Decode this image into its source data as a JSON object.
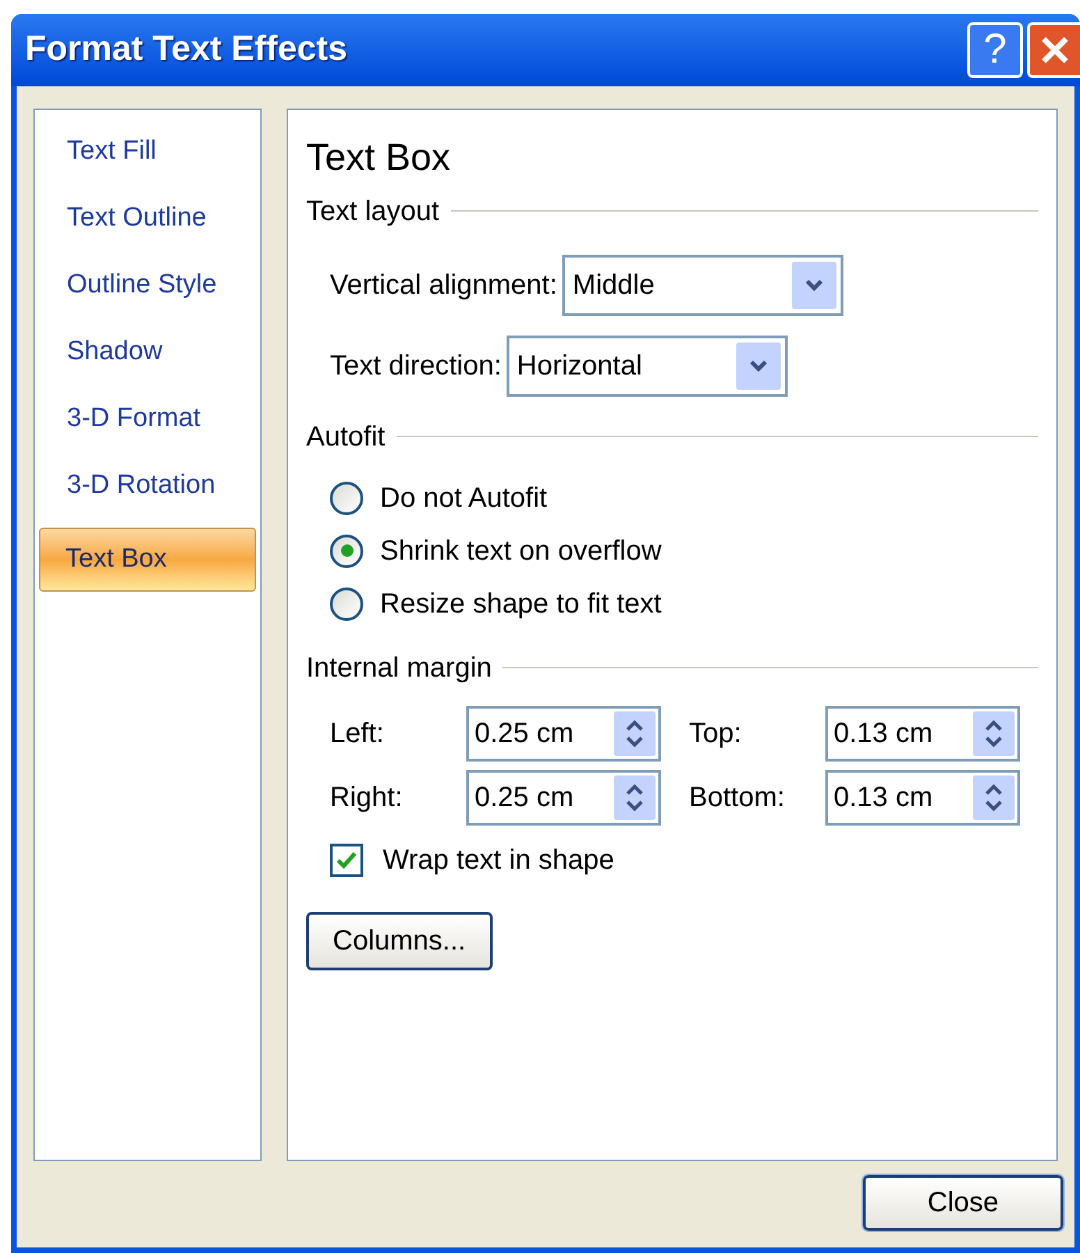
{
  "window": {
    "title": "Format Text Effects"
  },
  "title_buttons": [
    {
      "kind": "help",
      "label": "?"
    },
    {
      "kind": "close"
    }
  ],
  "sidebar": {
    "items": [
      {
        "label": "Text Fill",
        "selected": false
      },
      {
        "label": "Text Outline",
        "selected": false
      },
      {
        "label": "Outline Style",
        "selected": false
      },
      {
        "label": "Shadow",
        "selected": false
      },
      {
        "label": "3-D Format",
        "selected": false
      },
      {
        "label": "3-D Rotation",
        "selected": false
      },
      {
        "label": "Text Box",
        "selected": true
      }
    ]
  },
  "panel": {
    "heading": "Text Box",
    "text_layout": {
      "title": "Text layout",
      "dropdowns": [
        {
          "label": "Vertical alignment:",
          "value": "Middle"
        },
        {
          "label": "Text direction:",
          "value": "Horizontal"
        }
      ]
    },
    "autofit": {
      "title": "Autofit",
      "options": [
        {
          "label": "Do not Autofit",
          "selected": false
        },
        {
          "label": "Shrink text on overflow",
          "selected": true
        },
        {
          "label": "Resize shape to fit text",
          "selected": false
        }
      ]
    },
    "internal_margin": {
      "title": "Internal margin",
      "fields": [
        {
          "label": "Left:",
          "value": "0.25 cm"
        },
        {
          "label": "Top:",
          "value": "0.13 cm"
        },
        {
          "label": "Right:",
          "value": "0.25 cm"
        },
        {
          "label": "Bottom:",
          "value": "0.13 cm"
        }
      ],
      "wrap": {
        "label": "Wrap text in shape",
        "checked": true
      }
    },
    "columns_button": "Columns..."
  },
  "footer": {
    "close_button": "Close"
  }
}
